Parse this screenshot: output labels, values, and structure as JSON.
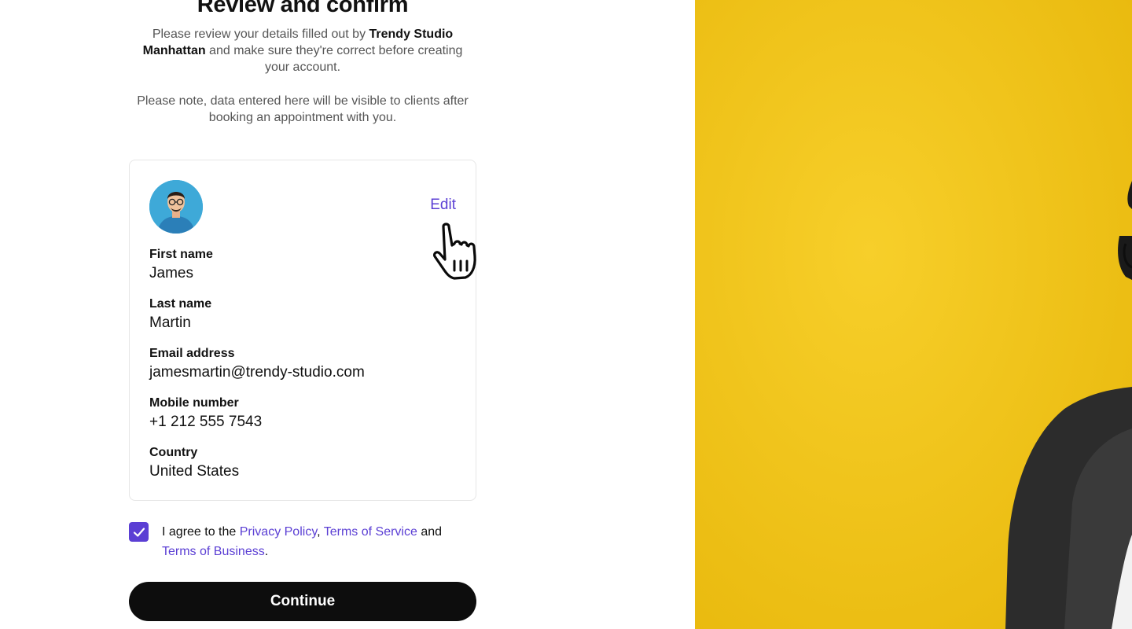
{
  "header": {
    "title": "Review and confirm",
    "intro_prefix": "Please review your details filled out by ",
    "business_name": "Trendy Studio Manhattan",
    "intro_suffix": " and make sure they're correct before creating your account.",
    "note": "Please note, data entered here will be visible to clients after booking an appointment with you."
  },
  "card": {
    "edit_label": "Edit",
    "fields": [
      {
        "label": "First name",
        "value": "James"
      },
      {
        "label": "Last name",
        "value": "Martin"
      },
      {
        "label": "Email address",
        "value": "jamesmartin@trendy-studio.com"
      },
      {
        "label": "Mobile number",
        "value": "+1 212 555 7543"
      },
      {
        "label": "Country",
        "value": "United States"
      }
    ]
  },
  "agreement": {
    "checked": true,
    "prefix": "I agree to the ",
    "privacy_policy": "Privacy Policy",
    "comma": ", ",
    "terms_of_service": "Terms of Service",
    "and": " and ",
    "terms_of_business": "Terms of Business",
    "period": "."
  },
  "continue_label": "Continue",
  "colors": {
    "accent": "#5b3fd4",
    "hero_background": "#f5c518",
    "button": "#0d0d0d"
  },
  "icons": {
    "avatar": "person-avatar",
    "cursor": "hand-pointer-icon",
    "check": "checkmark-icon"
  }
}
